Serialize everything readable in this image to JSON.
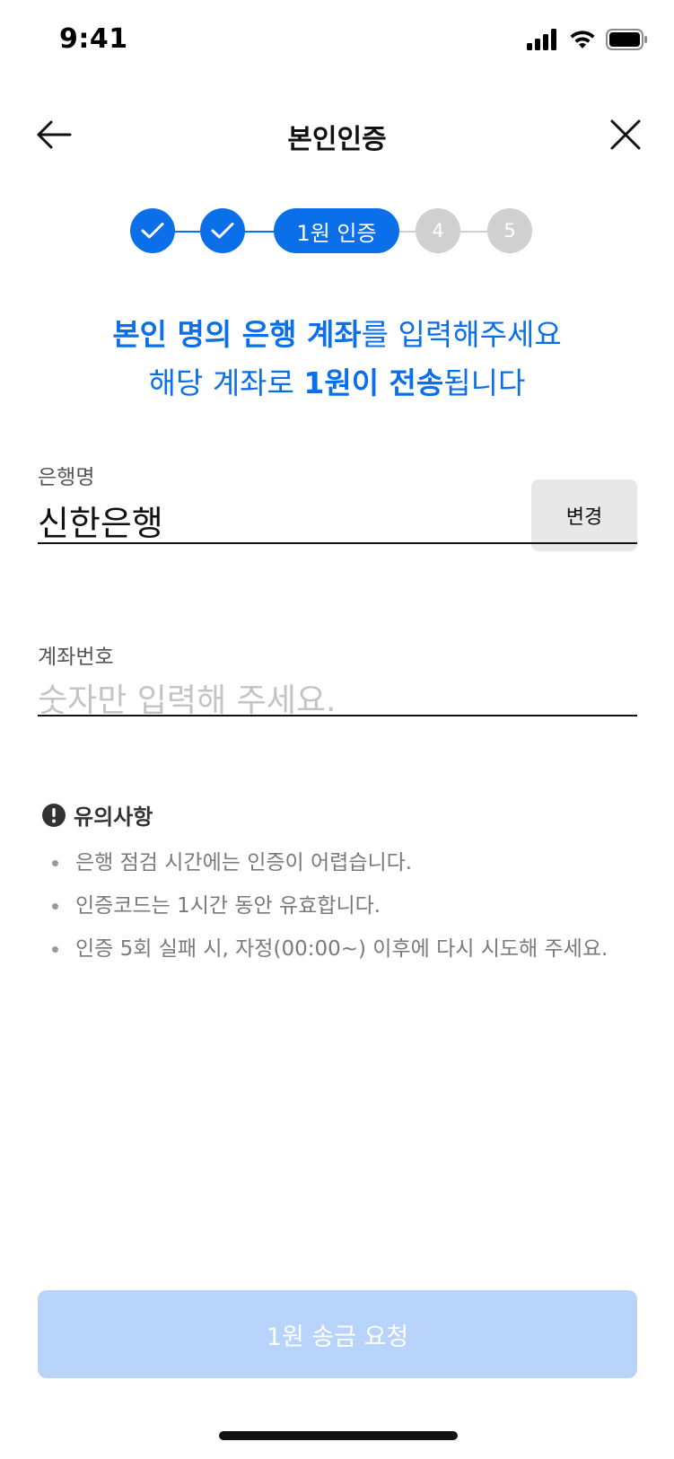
{
  "status_bar": {
    "time": "9:41",
    "icons": [
      "signal-icon",
      "wifi-icon",
      "battery-icon"
    ]
  },
  "nav": {
    "title": "본인인증",
    "back_icon": "arrow-left-icon",
    "close_icon": "close-icon"
  },
  "stepper": {
    "steps": [
      {
        "state": "done",
        "icon": "check-icon"
      },
      {
        "state": "done",
        "icon": "check-icon"
      },
      {
        "state": "current",
        "label": "1원 인증"
      },
      {
        "state": "pending",
        "label": "4"
      },
      {
        "state": "pending",
        "label": "5"
      }
    ]
  },
  "headline": {
    "line1_bold": "본인 명의 은행 계좌",
    "line1_rest": "를 입력해주세요",
    "line2_start": "해당 계좌로 ",
    "line2_bold": "1원이 전송",
    "line2_rest": "됩니다"
  },
  "bank_field": {
    "label": "은행명",
    "value": "신한은행",
    "change_label": "변경"
  },
  "account_field": {
    "label": "계좌번호",
    "value": "",
    "placeholder": "숫자만 입력해 주세요."
  },
  "notice": {
    "icon": "exclamation-circle-icon",
    "title": "유의사항",
    "items": [
      "은행 점검 시간에는 인증이 어렵습니다.",
      "인증코드는 1시간 동안 유효합니다.",
      "인증 5회 실패 시, 자정(00:00~) 이후에 다시 시도해 주세요."
    ]
  },
  "primary_button": {
    "label": "1원 송금 요청",
    "enabled": false
  },
  "colors": {
    "accent": "#0a6fe8",
    "step_pending": "#d0d0d0",
    "button_disabled": "#b9d4fb",
    "change_button_bg": "#e8e8e8"
  }
}
